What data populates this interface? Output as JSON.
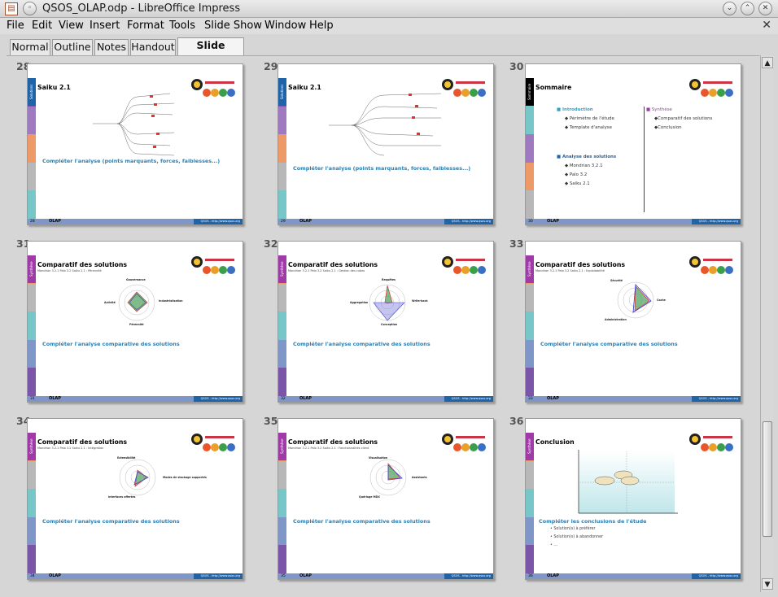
{
  "window": {
    "title": "QSOS_OLAP.odp - LibreOffice Impress",
    "close_doc_glyph": "✕"
  },
  "menu": [
    {
      "label": "File"
    },
    {
      "label": "Edit"
    },
    {
      "label": "View"
    },
    {
      "label": "Insert"
    },
    {
      "label": "Format"
    },
    {
      "label": "Tools"
    },
    {
      "label": "Slide Show"
    },
    {
      "label": "Window"
    },
    {
      "label": "Help"
    }
  ],
  "view_tabs": [
    {
      "label": "Normal"
    },
    {
      "label": "Outline"
    },
    {
      "label": "Notes"
    },
    {
      "label": "Handout"
    },
    {
      "label": "Slide Sorter",
      "active": true
    }
  ],
  "colors": {
    "strip": [
      "#7b56a8",
      "#a07ac0",
      "#ee9a68",
      "#b8b8b8",
      "#77c7c8"
    ],
    "footer": "#7f96c8",
    "footer_dark": "#1f63a8",
    "bullet": "#2e7fb0",
    "tag_saiku": "#1f63a8",
    "tag_sommaire": "#000000",
    "tag_synthese": "#a03aa8"
  },
  "slides": [
    {
      "num": "28",
      "tag": "Solutions",
      "title": "Saiku 2.1",
      "bullet": "Compléter l'analyse (points marquants, forces, faiblesses...)",
      "footer_num": "28",
      "footer_text": "OLAP",
      "footer_link": "QSOS - http://www.qsos.org"
    },
    {
      "num": "29",
      "tag": "Solutions",
      "title": "Saiku 2.1",
      "bullet": "Compléter l'analyse (points marquants, forces, faiblesses...)",
      "footer_num": "29",
      "footer_text": "OLAP",
      "footer_link": "QSOS - http://www.qsos.org"
    },
    {
      "num": "30",
      "tag": "Sommaire",
      "title": "Sommaire",
      "col1": {
        "head": "Introduction",
        "items": [
          "Périmètre de l'étude",
          "Template d'analyse"
        ],
        "head2": "Analyse des solutions",
        "items2": [
          "Mondrian 3.2.1",
          "Palo 3.2",
          "Saiku 2.1"
        ]
      },
      "col2": {
        "head": "Synthèse",
        "items": [
          "Comparatif des solutions",
          "Conclusion"
        ]
      },
      "footer_num": "30",
      "footer_text": "OLAP",
      "footer_link": "QSOS - http://www.qsos.org"
    },
    {
      "num": "31",
      "tag": "Synthèse",
      "title": "Comparatif des solutions",
      "legend": "Mondrian 3.2.1  Palo 3.2  Saiku 2.1 : Pérennité",
      "labels": [
        "Gouvernance",
        "Industrialisation",
        "Pérennité",
        "Activité"
      ],
      "bullet": "Compléter l'analyse comparative des solutions",
      "footer_num": "31",
      "footer_text": "OLAP",
      "footer_link": "QSOS - http://www.qsos.org"
    },
    {
      "num": "32",
      "tag": "Synthèse",
      "title": "Comparatif des solutions",
      "legend": "Mondrian 3.2.1  Palo 3.2  Saiku 2.1 : Gestion des cubes",
      "labels": [
        "Requêtes",
        "Write-back",
        "Conception",
        "Aggregation"
      ],
      "bullet": "Compléter l'analyse comparative des solutions",
      "footer_num": "32",
      "footer_text": "OLAP",
      "footer_link": "QSOS - http://www.qsos.org"
    },
    {
      "num": "33",
      "tag": "Synthèse",
      "title": "Comparatif des solutions",
      "legend": "Mondrian 3.2.1  Palo 3.2  Saiku 2.1 : Exploitabilité",
      "labels": [
        "Sécurité",
        "Cache",
        "Administration"
      ],
      "bullet": "Compléter l'analyse comparative des solutions",
      "footer_num": "33",
      "footer_text": "OLAP",
      "footer_link": "QSOS - http://www.qsos.org"
    },
    {
      "num": "34",
      "tag": "Synthèse",
      "title": "Comparatif des solutions",
      "legend": "Mondrian 3.2.1  Palo 3.2  Saiku 2.1 : Intégration",
      "labels": [
        "Extensibilité",
        "Modes de stockage supportés",
        "Interfaces offertes"
      ],
      "bullet": "Compléter l'analyse comparative des solutions",
      "footer_num": "34",
      "footer_text": "OLAP",
      "footer_link": "QSOS - http://www.qsos.org"
    },
    {
      "num": "35",
      "tag": "Synthèse",
      "title": "Comparatif des solutions",
      "legend": "Mondrian 3.2.1  Palo 3.2  Saiku 2.1 : Fonctionnalités client",
      "labels": [
        "Visualisation",
        "Assistants",
        "Quérlage MDX"
      ],
      "bullet": "Compléter l'analyse comparative des solutions",
      "footer_num": "35",
      "footer_text": "OLAP",
      "footer_link": "QSOS - http://www.qsos.org"
    },
    {
      "num": "36",
      "tag": "Synthèse",
      "title": "Conclusion",
      "bullet": "Compléter les conclusions de l'étude",
      "subs": [
        "Solution(s) à préférer",
        "Solution(s) à abandonner",
        "..."
      ],
      "footer_num": "36",
      "footer_text": "OLAP",
      "footer_link": "QSOS - http://www.qsos.org"
    }
  ]
}
